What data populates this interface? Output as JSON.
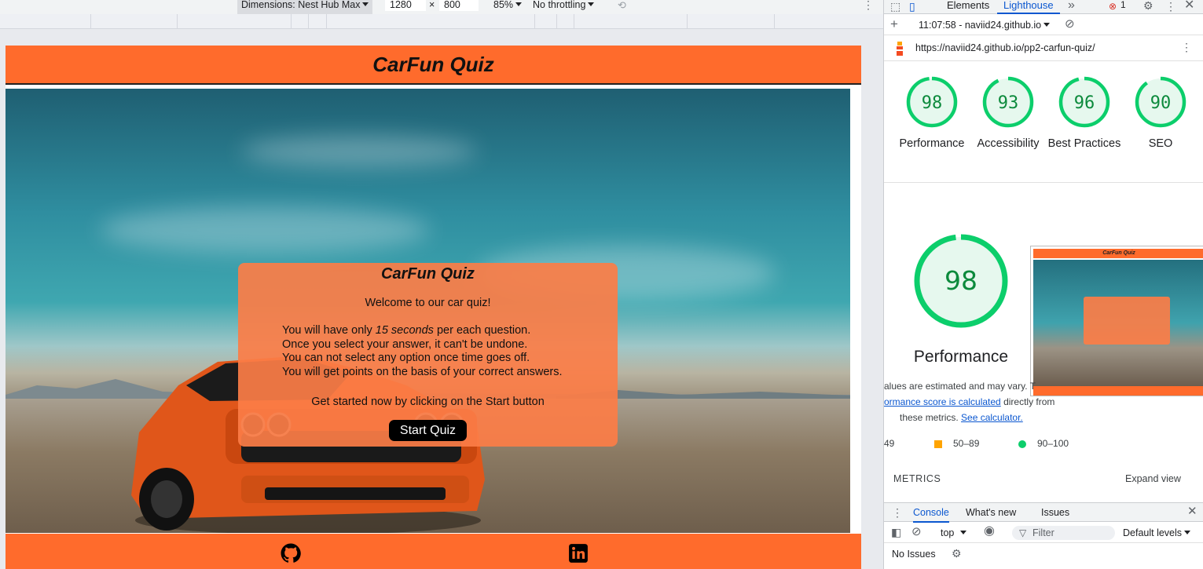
{
  "emulation": {
    "dimensions_label": "Dimensions: Nest Hub Max",
    "width": "1280",
    "times": "×",
    "height": "800",
    "zoom": "85%",
    "throttling": "No throttling"
  },
  "site": {
    "header_title": "CarFun Quiz",
    "quiz": {
      "title": "CarFun Quiz",
      "welcome": "Welcome to our car quiz!",
      "rule1_prefix": "You will have only ",
      "rule1_em": "15 seconds",
      "rule1_suffix": " per each question.",
      "rule2": "Once you select your answer, it can't be undone.",
      "rule3": "You can not select any option once time goes off.",
      "rule4": "You will get points on the basis of your correct answers.",
      "start_text": "Get started now by clicking on the Start button",
      "start_button": "Start Quiz"
    },
    "footer": {
      "github_icon": "github-icon",
      "linkedin_icon": "linkedin-icon"
    }
  },
  "devtools": {
    "tabs": {
      "elements": "Elements",
      "lighthouse": "Lighthouse",
      "more": "»",
      "error_count": "1"
    },
    "report_time": "11:07:58 - naviid24.github.io",
    "url": "https://naviid24.github.io/pp2-carfun-quiz/",
    "scores": [
      {
        "value": 98,
        "label": "Performance"
      },
      {
        "value": 93,
        "label": "Accessibility"
      },
      {
        "value": 96,
        "label": "Best Practices"
      },
      {
        "value": 90,
        "label": "SEO"
      }
    ],
    "main_score": {
      "value": 98,
      "label": "Performance"
    },
    "thumbnail_title": "CarFun Quiz",
    "note": {
      "line1": "alues are estimated and may vary. T",
      "link1": "ormance score is calculated",
      "line2": " directly from",
      "line3": "these metrics. ",
      "link2": "See calculator."
    },
    "legend": {
      "low": "49",
      "mid": "50–89",
      "high": "90–100"
    },
    "metrics_title": "METRICS",
    "expand_view": "Expand view",
    "console_tabs": {
      "console": "Console",
      "whats_new": "What's new",
      "issues": "Issues"
    },
    "context": "top",
    "filter_placeholder": "Filter",
    "levels": "Default levels",
    "no_issues": "No Issues"
  },
  "colors": {
    "brand_orange": "#ff6b2c",
    "score_green": "#0cce6b",
    "link_blue": "#0b57d0"
  }
}
